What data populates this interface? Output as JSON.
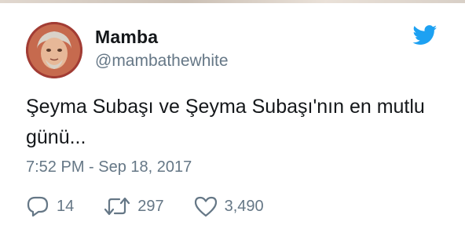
{
  "tweet": {
    "author": {
      "display_name": "Mamba",
      "handle": "@mambathewhite",
      "avatar_icon": "avatar-photo"
    },
    "text": "Şeyma Subaşı ve Şeyma Subaşı'nın en mutlu günü...",
    "timestamp": "7:52 PM - Sep 18, 2017",
    "actions": {
      "replies": "14",
      "retweets": "297",
      "likes": "3,490"
    }
  },
  "colors": {
    "twitter_blue": "#1da1f2",
    "text_primary": "#14171a",
    "text_secondary": "#657786"
  },
  "icons": {
    "brand": "twitter-bird-icon",
    "reply": "reply-icon",
    "retweet": "retweet-icon",
    "like": "heart-icon"
  }
}
